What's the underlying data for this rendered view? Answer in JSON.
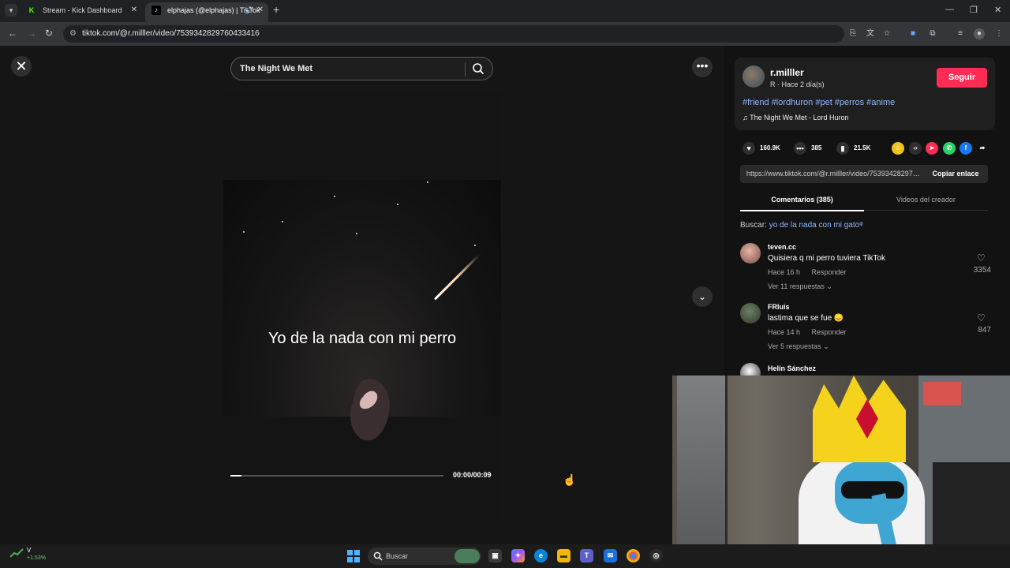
{
  "browser": {
    "tabs": [
      {
        "label": "Stream - Kick Dashboard",
        "favicon": "K"
      },
      {
        "label": "elphajas (@elphajas) | TikTok",
        "favicon": "♪"
      }
    ],
    "url": "tiktok.com/@r.milller/video/7539342829760433416"
  },
  "video": {
    "search_query": "The Night We Met",
    "caption": "Yo de la nada con mi perro",
    "time": "00:00/00:09",
    "progress": 0.05
  },
  "author": {
    "username": "r.milller",
    "subtitle": "R · Hace 2 día(s)",
    "follow_label": "Seguir",
    "hashtags": "#friend #lordhuron #pet #perros #anime",
    "music": "The Night We Met - Lord Huron"
  },
  "stats": {
    "likes": "160.9K",
    "comments": "385",
    "saves": "21.5K"
  },
  "share": {
    "link": "https://www.tiktok.com/@r.milller/video/7539342829760433416",
    "copy_label": "Copiar enlace"
  },
  "panel_tabs": {
    "comments": "Comentarios (385)",
    "creator_videos": "Videos del creador"
  },
  "search_suggestion": {
    "prefix": "Buscar:",
    "keyword": "yo de la nada con mi gato"
  },
  "comments": [
    {
      "user": "teven.cc",
      "text": "Quisiera q mi perro tuviera TikTok",
      "time": "Hace 16 h",
      "reply": "Responder",
      "replies": "Ver 11 respuestas",
      "likes": "3354"
    },
    {
      "user": "FRluis",
      "text": "lastima que se fue 😞",
      "time": "Hace 14 h",
      "reply": "Responder",
      "replies": "Ver 5 respuestas",
      "likes": "847"
    },
    {
      "user": "Helin Sánchez"
    }
  ],
  "taskbar": {
    "ticker_label": "V",
    "ticker_value": "+1.53%",
    "search_placeholder": "Buscar"
  }
}
